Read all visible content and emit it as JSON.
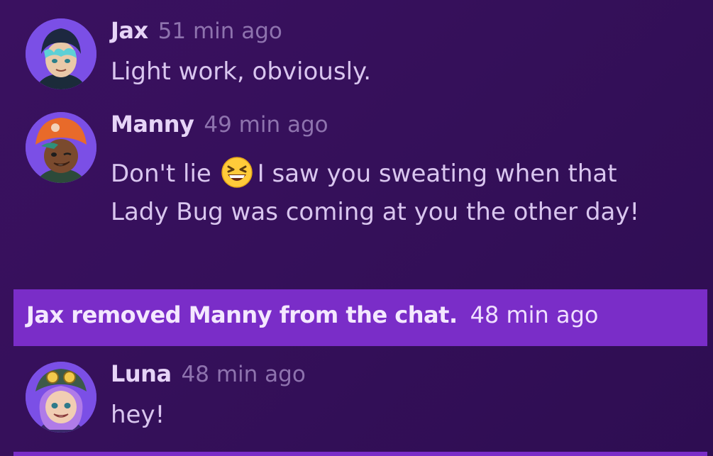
{
  "chat": {
    "messages": [
      {
        "author": "Jax",
        "time": "51 min ago",
        "text": "Light work, obviously.",
        "avatar_icon": "jax-avatar"
      },
      {
        "author": "Manny",
        "time": "49 min ago",
        "text_before_emoji": "Don't lie",
        "emoji": "grinning-squinting-face-emoji",
        "text_after_emoji": "I saw you sweating when that Lady Bug was coming at you the other day!",
        "avatar_icon": "manny-avatar"
      },
      {
        "author": "Luna",
        "time": "48 min ago",
        "text": "hey!",
        "avatar_icon": "luna-avatar"
      }
    ],
    "system_notice": {
      "text": "Jax removed Manny from the chat.",
      "time": "48 min ago"
    }
  },
  "colors": {
    "background": "#35105a",
    "system_banner": "#7a2dc8",
    "author_text": "#e6d4f7",
    "timestamp_text": "#8e73ae",
    "message_text": "#d9c6ef"
  }
}
